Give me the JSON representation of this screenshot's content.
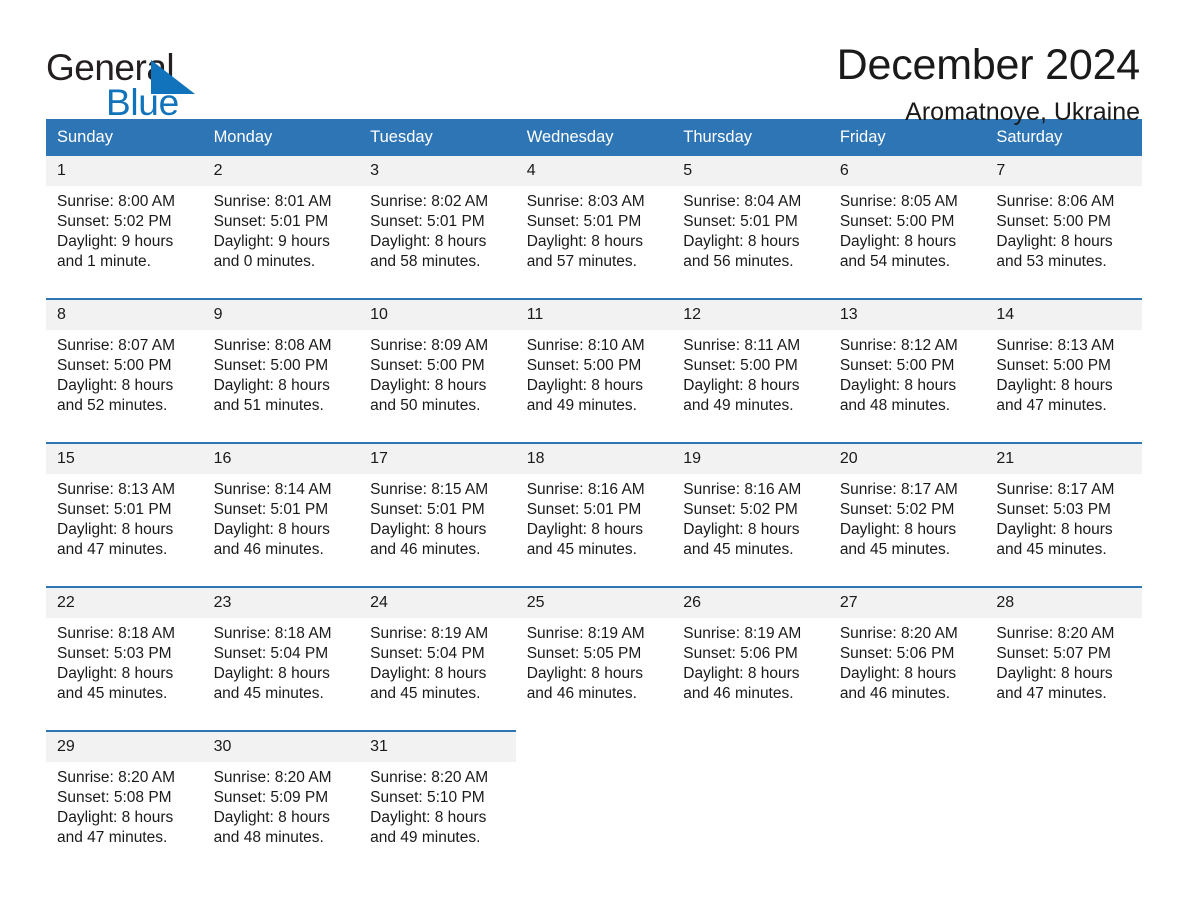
{
  "brand": {
    "name_part1": "General",
    "name_part2": "Blue",
    "logo_icon": "triangle-logo-icon",
    "accent_color": "#1173bb"
  },
  "header": {
    "title": "December 2024",
    "location": "Aromatnoye, Ukraine"
  },
  "theme": {
    "header_blue": "#2e75b6",
    "daynum_band": "#f2f2f2",
    "text": "#1a1a1a"
  },
  "calendar": {
    "weekday_headers": [
      "Sunday",
      "Monday",
      "Tuesday",
      "Wednesday",
      "Thursday",
      "Friday",
      "Saturday"
    ],
    "weeks": [
      [
        {
          "day": "1",
          "sunrise": "Sunrise: 8:00 AM",
          "sunset": "Sunset: 5:02 PM",
          "daylight_line1": "Daylight: 9 hours",
          "daylight_line2": "and 1 minute."
        },
        {
          "day": "2",
          "sunrise": "Sunrise: 8:01 AM",
          "sunset": "Sunset: 5:01 PM",
          "daylight_line1": "Daylight: 9 hours",
          "daylight_line2": "and 0 minutes."
        },
        {
          "day": "3",
          "sunrise": "Sunrise: 8:02 AM",
          "sunset": "Sunset: 5:01 PM",
          "daylight_line1": "Daylight: 8 hours",
          "daylight_line2": "and 58 minutes."
        },
        {
          "day": "4",
          "sunrise": "Sunrise: 8:03 AM",
          "sunset": "Sunset: 5:01 PM",
          "daylight_line1": "Daylight: 8 hours",
          "daylight_line2": "and 57 minutes."
        },
        {
          "day": "5",
          "sunrise": "Sunrise: 8:04 AM",
          "sunset": "Sunset: 5:01 PM",
          "daylight_line1": "Daylight: 8 hours",
          "daylight_line2": "and 56 minutes."
        },
        {
          "day": "6",
          "sunrise": "Sunrise: 8:05 AM",
          "sunset": "Sunset: 5:00 PM",
          "daylight_line1": "Daylight: 8 hours",
          "daylight_line2": "and 54 minutes."
        },
        {
          "day": "7",
          "sunrise": "Sunrise: 8:06 AM",
          "sunset": "Sunset: 5:00 PM",
          "daylight_line1": "Daylight: 8 hours",
          "daylight_line2": "and 53 minutes."
        }
      ],
      [
        {
          "day": "8",
          "sunrise": "Sunrise: 8:07 AM",
          "sunset": "Sunset: 5:00 PM",
          "daylight_line1": "Daylight: 8 hours",
          "daylight_line2": "and 52 minutes."
        },
        {
          "day": "9",
          "sunrise": "Sunrise: 8:08 AM",
          "sunset": "Sunset: 5:00 PM",
          "daylight_line1": "Daylight: 8 hours",
          "daylight_line2": "and 51 minutes."
        },
        {
          "day": "10",
          "sunrise": "Sunrise: 8:09 AM",
          "sunset": "Sunset: 5:00 PM",
          "daylight_line1": "Daylight: 8 hours",
          "daylight_line2": "and 50 minutes."
        },
        {
          "day": "11",
          "sunrise": "Sunrise: 8:10 AM",
          "sunset": "Sunset: 5:00 PM",
          "daylight_line1": "Daylight: 8 hours",
          "daylight_line2": "and 49 minutes."
        },
        {
          "day": "12",
          "sunrise": "Sunrise: 8:11 AM",
          "sunset": "Sunset: 5:00 PM",
          "daylight_line1": "Daylight: 8 hours",
          "daylight_line2": "and 49 minutes."
        },
        {
          "day": "13",
          "sunrise": "Sunrise: 8:12 AM",
          "sunset": "Sunset: 5:00 PM",
          "daylight_line1": "Daylight: 8 hours",
          "daylight_line2": "and 48 minutes."
        },
        {
          "day": "14",
          "sunrise": "Sunrise: 8:13 AM",
          "sunset": "Sunset: 5:00 PM",
          "daylight_line1": "Daylight: 8 hours",
          "daylight_line2": "and 47 minutes."
        }
      ],
      [
        {
          "day": "15",
          "sunrise": "Sunrise: 8:13 AM",
          "sunset": "Sunset: 5:01 PM",
          "daylight_line1": "Daylight: 8 hours",
          "daylight_line2": "and 47 minutes."
        },
        {
          "day": "16",
          "sunrise": "Sunrise: 8:14 AM",
          "sunset": "Sunset: 5:01 PM",
          "daylight_line1": "Daylight: 8 hours",
          "daylight_line2": "and 46 minutes."
        },
        {
          "day": "17",
          "sunrise": "Sunrise: 8:15 AM",
          "sunset": "Sunset: 5:01 PM",
          "daylight_line1": "Daylight: 8 hours",
          "daylight_line2": "and 46 minutes."
        },
        {
          "day": "18",
          "sunrise": "Sunrise: 8:16 AM",
          "sunset": "Sunset: 5:01 PM",
          "daylight_line1": "Daylight: 8 hours",
          "daylight_line2": "and 45 minutes."
        },
        {
          "day": "19",
          "sunrise": "Sunrise: 8:16 AM",
          "sunset": "Sunset: 5:02 PM",
          "daylight_line1": "Daylight: 8 hours",
          "daylight_line2": "and 45 minutes."
        },
        {
          "day": "20",
          "sunrise": "Sunrise: 8:17 AM",
          "sunset": "Sunset: 5:02 PM",
          "daylight_line1": "Daylight: 8 hours",
          "daylight_line2": "and 45 minutes."
        },
        {
          "day": "21",
          "sunrise": "Sunrise: 8:17 AM",
          "sunset": "Sunset: 5:03 PM",
          "daylight_line1": "Daylight: 8 hours",
          "daylight_line2": "and 45 minutes."
        }
      ],
      [
        {
          "day": "22",
          "sunrise": "Sunrise: 8:18 AM",
          "sunset": "Sunset: 5:03 PM",
          "daylight_line1": "Daylight: 8 hours",
          "daylight_line2": "and 45 minutes."
        },
        {
          "day": "23",
          "sunrise": "Sunrise: 8:18 AM",
          "sunset": "Sunset: 5:04 PM",
          "daylight_line1": "Daylight: 8 hours",
          "daylight_line2": "and 45 minutes."
        },
        {
          "day": "24",
          "sunrise": "Sunrise: 8:19 AM",
          "sunset": "Sunset: 5:04 PM",
          "daylight_line1": "Daylight: 8 hours",
          "daylight_line2": "and 45 minutes."
        },
        {
          "day": "25",
          "sunrise": "Sunrise: 8:19 AM",
          "sunset": "Sunset: 5:05 PM",
          "daylight_line1": "Daylight: 8 hours",
          "daylight_line2": "and 46 minutes."
        },
        {
          "day": "26",
          "sunrise": "Sunrise: 8:19 AM",
          "sunset": "Sunset: 5:06 PM",
          "daylight_line1": "Daylight: 8 hours",
          "daylight_line2": "and 46 minutes."
        },
        {
          "day": "27",
          "sunrise": "Sunrise: 8:20 AM",
          "sunset": "Sunset: 5:06 PM",
          "daylight_line1": "Daylight: 8 hours",
          "daylight_line2": "and 46 minutes."
        },
        {
          "day": "28",
          "sunrise": "Sunrise: 8:20 AM",
          "sunset": "Sunset: 5:07 PM",
          "daylight_line1": "Daylight: 8 hours",
          "daylight_line2": "and 47 minutes."
        }
      ],
      [
        {
          "day": "29",
          "sunrise": "Sunrise: 8:20 AM",
          "sunset": "Sunset: 5:08 PM",
          "daylight_line1": "Daylight: 8 hours",
          "daylight_line2": "and 47 minutes."
        },
        {
          "day": "30",
          "sunrise": "Sunrise: 8:20 AM",
          "sunset": "Sunset: 5:09 PM",
          "daylight_line1": "Daylight: 8 hours",
          "daylight_line2": "and 48 minutes."
        },
        {
          "day": "31",
          "sunrise": "Sunrise: 8:20 AM",
          "sunset": "Sunset: 5:10 PM",
          "daylight_line1": "Daylight: 8 hours",
          "daylight_line2": "and 49 minutes."
        },
        {
          "day": "",
          "sunrise": "",
          "sunset": "",
          "daylight_line1": "",
          "daylight_line2": ""
        },
        {
          "day": "",
          "sunrise": "",
          "sunset": "",
          "daylight_line1": "",
          "daylight_line2": ""
        },
        {
          "day": "",
          "sunrise": "",
          "sunset": "",
          "daylight_line1": "",
          "daylight_line2": ""
        },
        {
          "day": "",
          "sunrise": "",
          "sunset": "",
          "daylight_line1": "",
          "daylight_line2": ""
        }
      ]
    ]
  }
}
